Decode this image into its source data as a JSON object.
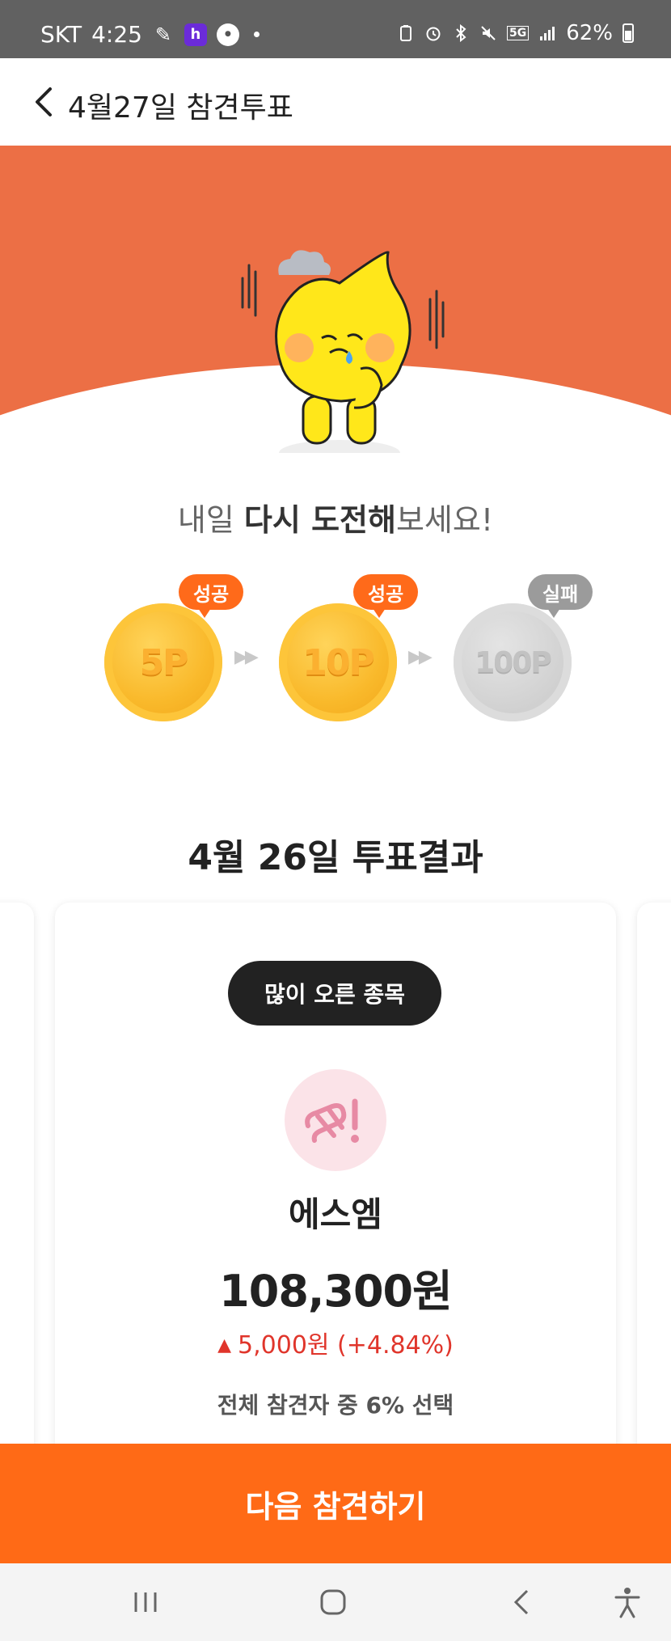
{
  "status_bar": {
    "carrier": "SKT",
    "time": "4:25",
    "battery": "62%",
    "network": "5G"
  },
  "header": {
    "title": "4월27일 참견투표"
  },
  "hero": {
    "character": "crying-yellow-character"
  },
  "message": {
    "prefix": "내일 ",
    "emphasis": "다시 도전해",
    "suffix": "보세요!"
  },
  "coins": [
    {
      "label": "5P",
      "status": "성공",
      "color": "gold"
    },
    {
      "label": "10P",
      "status": "성공",
      "color": "gold"
    },
    {
      "label": "100P",
      "status": "실패",
      "color": "grey"
    }
  ],
  "result": {
    "title": "4월 26일 투표결과"
  },
  "card": {
    "category": "많이 오른 종목",
    "stock_name": "에스엠",
    "price": "108,300원",
    "change": "5,000원 (+4.84%)",
    "vote_share": "전체 참견자 중 6% 선택"
  },
  "next_button": {
    "label": "다음 참견하기"
  },
  "colors": {
    "accent": "#ff6a16",
    "hero_bg": "#ec6f45",
    "rise": "#e0352b",
    "badge_success": "#ff6a1a",
    "badge_fail": "#9b9b9b"
  }
}
